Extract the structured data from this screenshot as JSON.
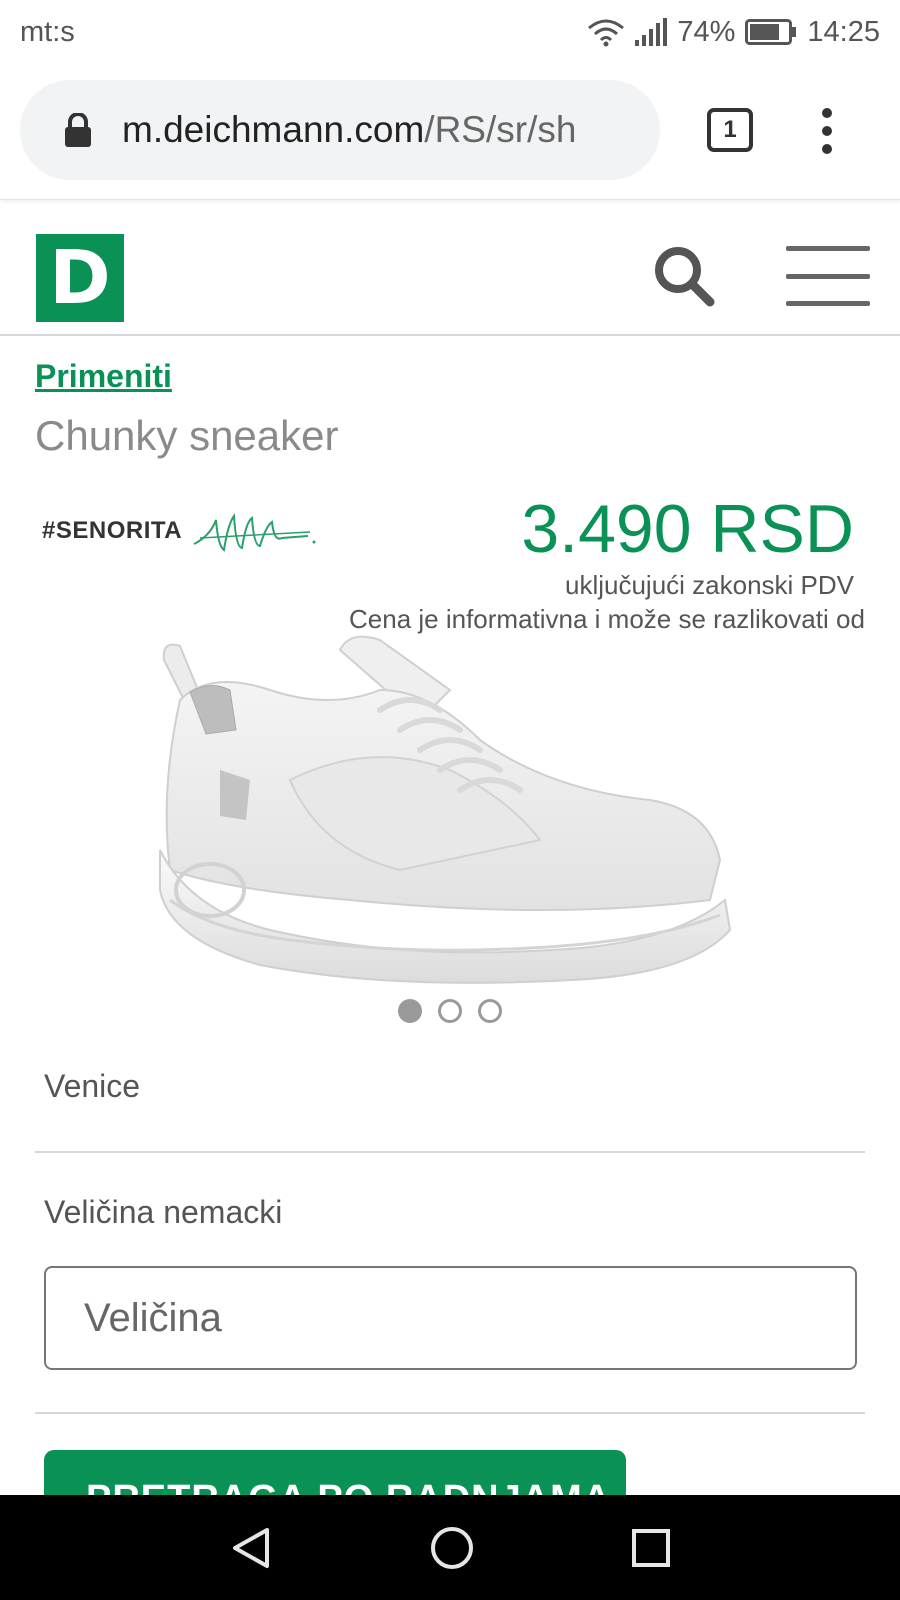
{
  "status_bar": {
    "carrier": "mt:s",
    "battery": "74%",
    "time": "14:25"
  },
  "browser": {
    "url_host": "m.deichmann.com",
    "url_path": "/RS/sr/sh",
    "tab_count": "1"
  },
  "header": {
    "logo_letter": "D"
  },
  "product": {
    "brand_link": "Primeniti",
    "name": "Chunky sneaker",
    "brand_logo_text": "#SENORITA",
    "price": "3.490 RSD",
    "vat_note": "uključujući zakonski PDV",
    "price_note": "Cena je informativna i može se razlikovati od",
    "image_dots": 3,
    "active_image": 1
  },
  "variant": {
    "label": "Venice"
  },
  "size": {
    "label": "Veličina nemacki",
    "select_placeholder": "Veličina"
  },
  "store_search_button": "PRETRAGA PO RADNJAMA",
  "colors": {
    "brand_green": "#0a9156",
    "status_text": "#555555"
  }
}
